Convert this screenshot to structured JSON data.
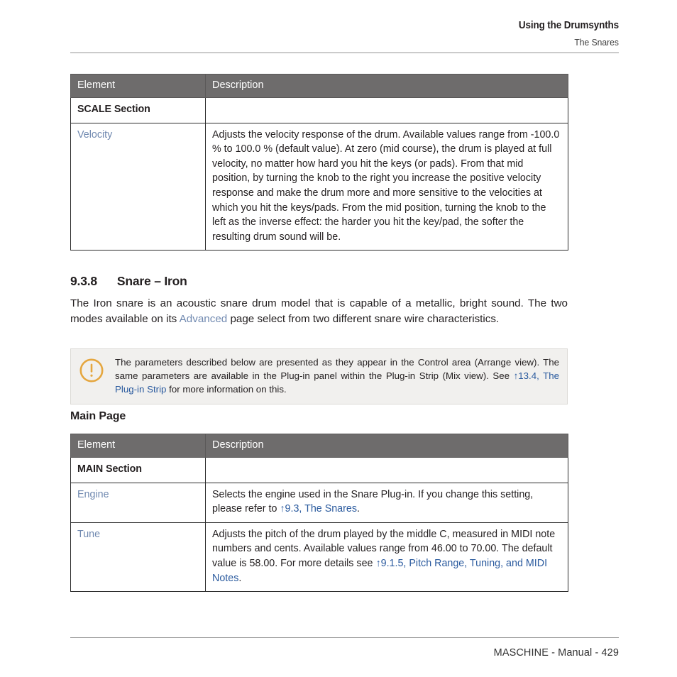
{
  "running_head": {
    "title": "Using the Drumsynths",
    "subtitle": "The Snares"
  },
  "table_scale": {
    "headers": [
      "Element",
      "Description"
    ],
    "rows": [
      {
        "element": "SCALE Section",
        "element_type": "section",
        "description": ""
      },
      {
        "element": "Velocity",
        "element_type": "parameter",
        "description": "Adjusts the velocity response of the drum. Available values range from -100.0 % to 100.0 % (default value). At zero (mid course), the drum is played at full velocity, no matter how hard you hit the keys (or pads). From that mid position, by turning the knob to the right you increase the positive velocity response and make the drum more and more sensitive to the velocities at which you hit the keys/pads. From the mid position, turning the knob to the left as the inverse effect: the harder you hit the key/pad, the softer the resulting drum sound will be."
      }
    ]
  },
  "section": {
    "number": "9.3.8",
    "title": "Snare – Iron",
    "heading_full": "9.3.8      Snare – Iron"
  },
  "intro": {
    "part1": "The Iron snare is an acoustic snare drum model that is capable of a metallic, bright sound. The two modes available on its ",
    "link": "Advanced",
    "part2": " page select from two different snare wire characteristics."
  },
  "note": {
    "icon": "exclamation-circle-icon",
    "icon_color": "#e5a63e",
    "part1": "The parameters described below are presented as they appear in the Control area (Arrange view). The same parameters are available in the Plug-in panel within the Plug-in Strip (Mix view). See ",
    "link": "↑13.4, The Plug-in Strip",
    "part2": " for more information on this."
  },
  "subheading": {
    "title": "Main Page"
  },
  "table_main": {
    "headers": [
      "Element",
      "Description"
    ],
    "rows": [
      {
        "element": "MAIN Section",
        "element_type": "section",
        "description": ""
      },
      {
        "element": "Engine",
        "element_type": "parameter",
        "desc_part1": "Selects the engine used in the Snare Plug-in. If you change this setting, please refer to ",
        "desc_link": "↑9.3, The Snares",
        "desc_part2": "."
      },
      {
        "element": "Tune",
        "element_type": "parameter",
        "desc_part1": "Adjusts the pitch of the drum played by the middle C, measured in MIDI note numbers and cents. Available values range from 46.00 to 70.00. The default value is 58.00. For more details see ",
        "desc_link": "↑9.1.5, Pitch Range, Tuning, and MIDI Notes",
        "desc_part2": "."
      }
    ]
  },
  "footer": {
    "text": "MASCHINE - Manual - 429"
  },
  "colors": {
    "table_header_bg": "#6e6c6c",
    "param_link": "#7089b0",
    "body_link": "#2a5a9e",
    "note_bg": "#f1f0ee",
    "note_icon": "#e5a63e"
  }
}
